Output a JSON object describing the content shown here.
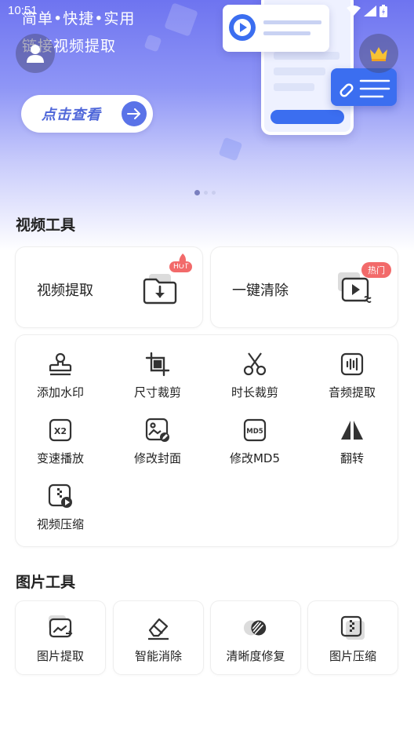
{
  "status_bar": {
    "time": "10:51"
  },
  "banner": {
    "headline": "简单•快捷•实用",
    "subline": "链接视频提取",
    "cta_label": "点击查看",
    "slide_count": 3,
    "active_slide": 1
  },
  "video_tools": {
    "title": "视频工具",
    "featured": [
      {
        "label": "视频提取",
        "badge": "HOT",
        "icon": "download-folder-icon"
      },
      {
        "label": "一键清除",
        "badge": "热门",
        "icon": "video-clean-icon"
      }
    ],
    "grid": [
      {
        "label": "添加水印",
        "icon": "stamp-icon"
      },
      {
        "label": "尺寸裁剪",
        "icon": "crop-icon"
      },
      {
        "label": "时长裁剪",
        "icon": "scissors-icon"
      },
      {
        "label": "音频提取",
        "icon": "audio-wave-icon"
      },
      {
        "label": "变速播放",
        "icon": "speed-x2-icon"
      },
      {
        "label": "修改封面",
        "icon": "edit-cover-icon"
      },
      {
        "label": "修改MD5",
        "icon": "md5-icon"
      },
      {
        "label": "翻转",
        "icon": "flip-icon"
      },
      {
        "label": "视频压缩",
        "icon": "video-compress-icon"
      }
    ]
  },
  "image_tools": {
    "title": "图片工具",
    "items": [
      {
        "label": "图片提取",
        "icon": "image-extract-icon"
      },
      {
        "label": "智能消除",
        "icon": "eraser-icon"
      },
      {
        "label": "清晰度修复",
        "icon": "clarity-icon"
      },
      {
        "label": "图片压缩",
        "icon": "image-compress-icon"
      }
    ]
  },
  "colors": {
    "accent": "#5a73e8",
    "badge_red": "#f26a6a",
    "banner_top": "#6e74f0",
    "icon_dark": "#333333"
  }
}
